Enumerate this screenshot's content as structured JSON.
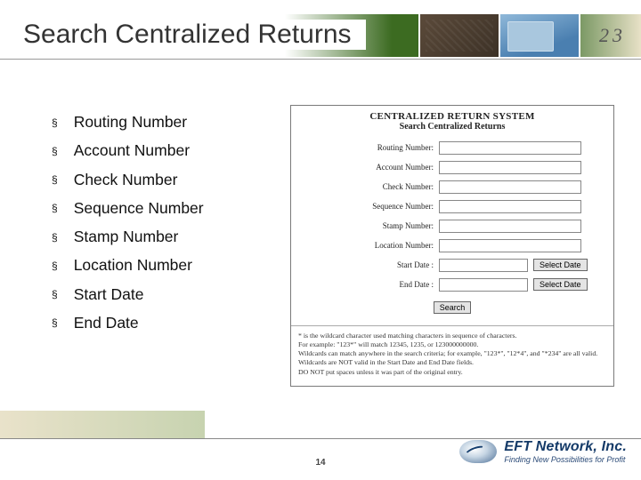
{
  "title": "Search Centralized Returns",
  "bullets": [
    "Routing Number",
    "Account Number",
    "Check Number",
    "Sequence Number",
    "Stamp Number",
    "Location Number",
    "Start Date",
    "End Date"
  ],
  "panel": {
    "heading1": "CENTRALIZED RETURN SYSTEM",
    "heading2": "Search Centralized Returns",
    "fields": {
      "routing": "Routing Number:",
      "account": "Account Number:",
      "check": "Check Number:",
      "sequence": "Sequence Number:",
      "stamp": "Stamp Number:",
      "location": "Location Number:",
      "start": "Start Date :",
      "end": "End Date :"
    },
    "buttons": {
      "select_date": "Select Date",
      "search": "Search"
    },
    "footnote": [
      "* is the wildcard character used matching characters in sequence of characters.",
      "For example: \"123*\" will match 12345, 1235, or 123000000000.",
      "Wildcards can match anywhere in the search criteria; for example, \"123*\", \"12*4\", and \"*234\" are all valid.",
      "Wildcards are NOT valid in the Start Date and End Date fields.",
      "DO NOT put spaces unless it was part of the original entry."
    ]
  },
  "page_number": "14",
  "logo": {
    "company": "EFT Network, Inc.",
    "tagline": "Finding New Possibilities for Profit"
  }
}
